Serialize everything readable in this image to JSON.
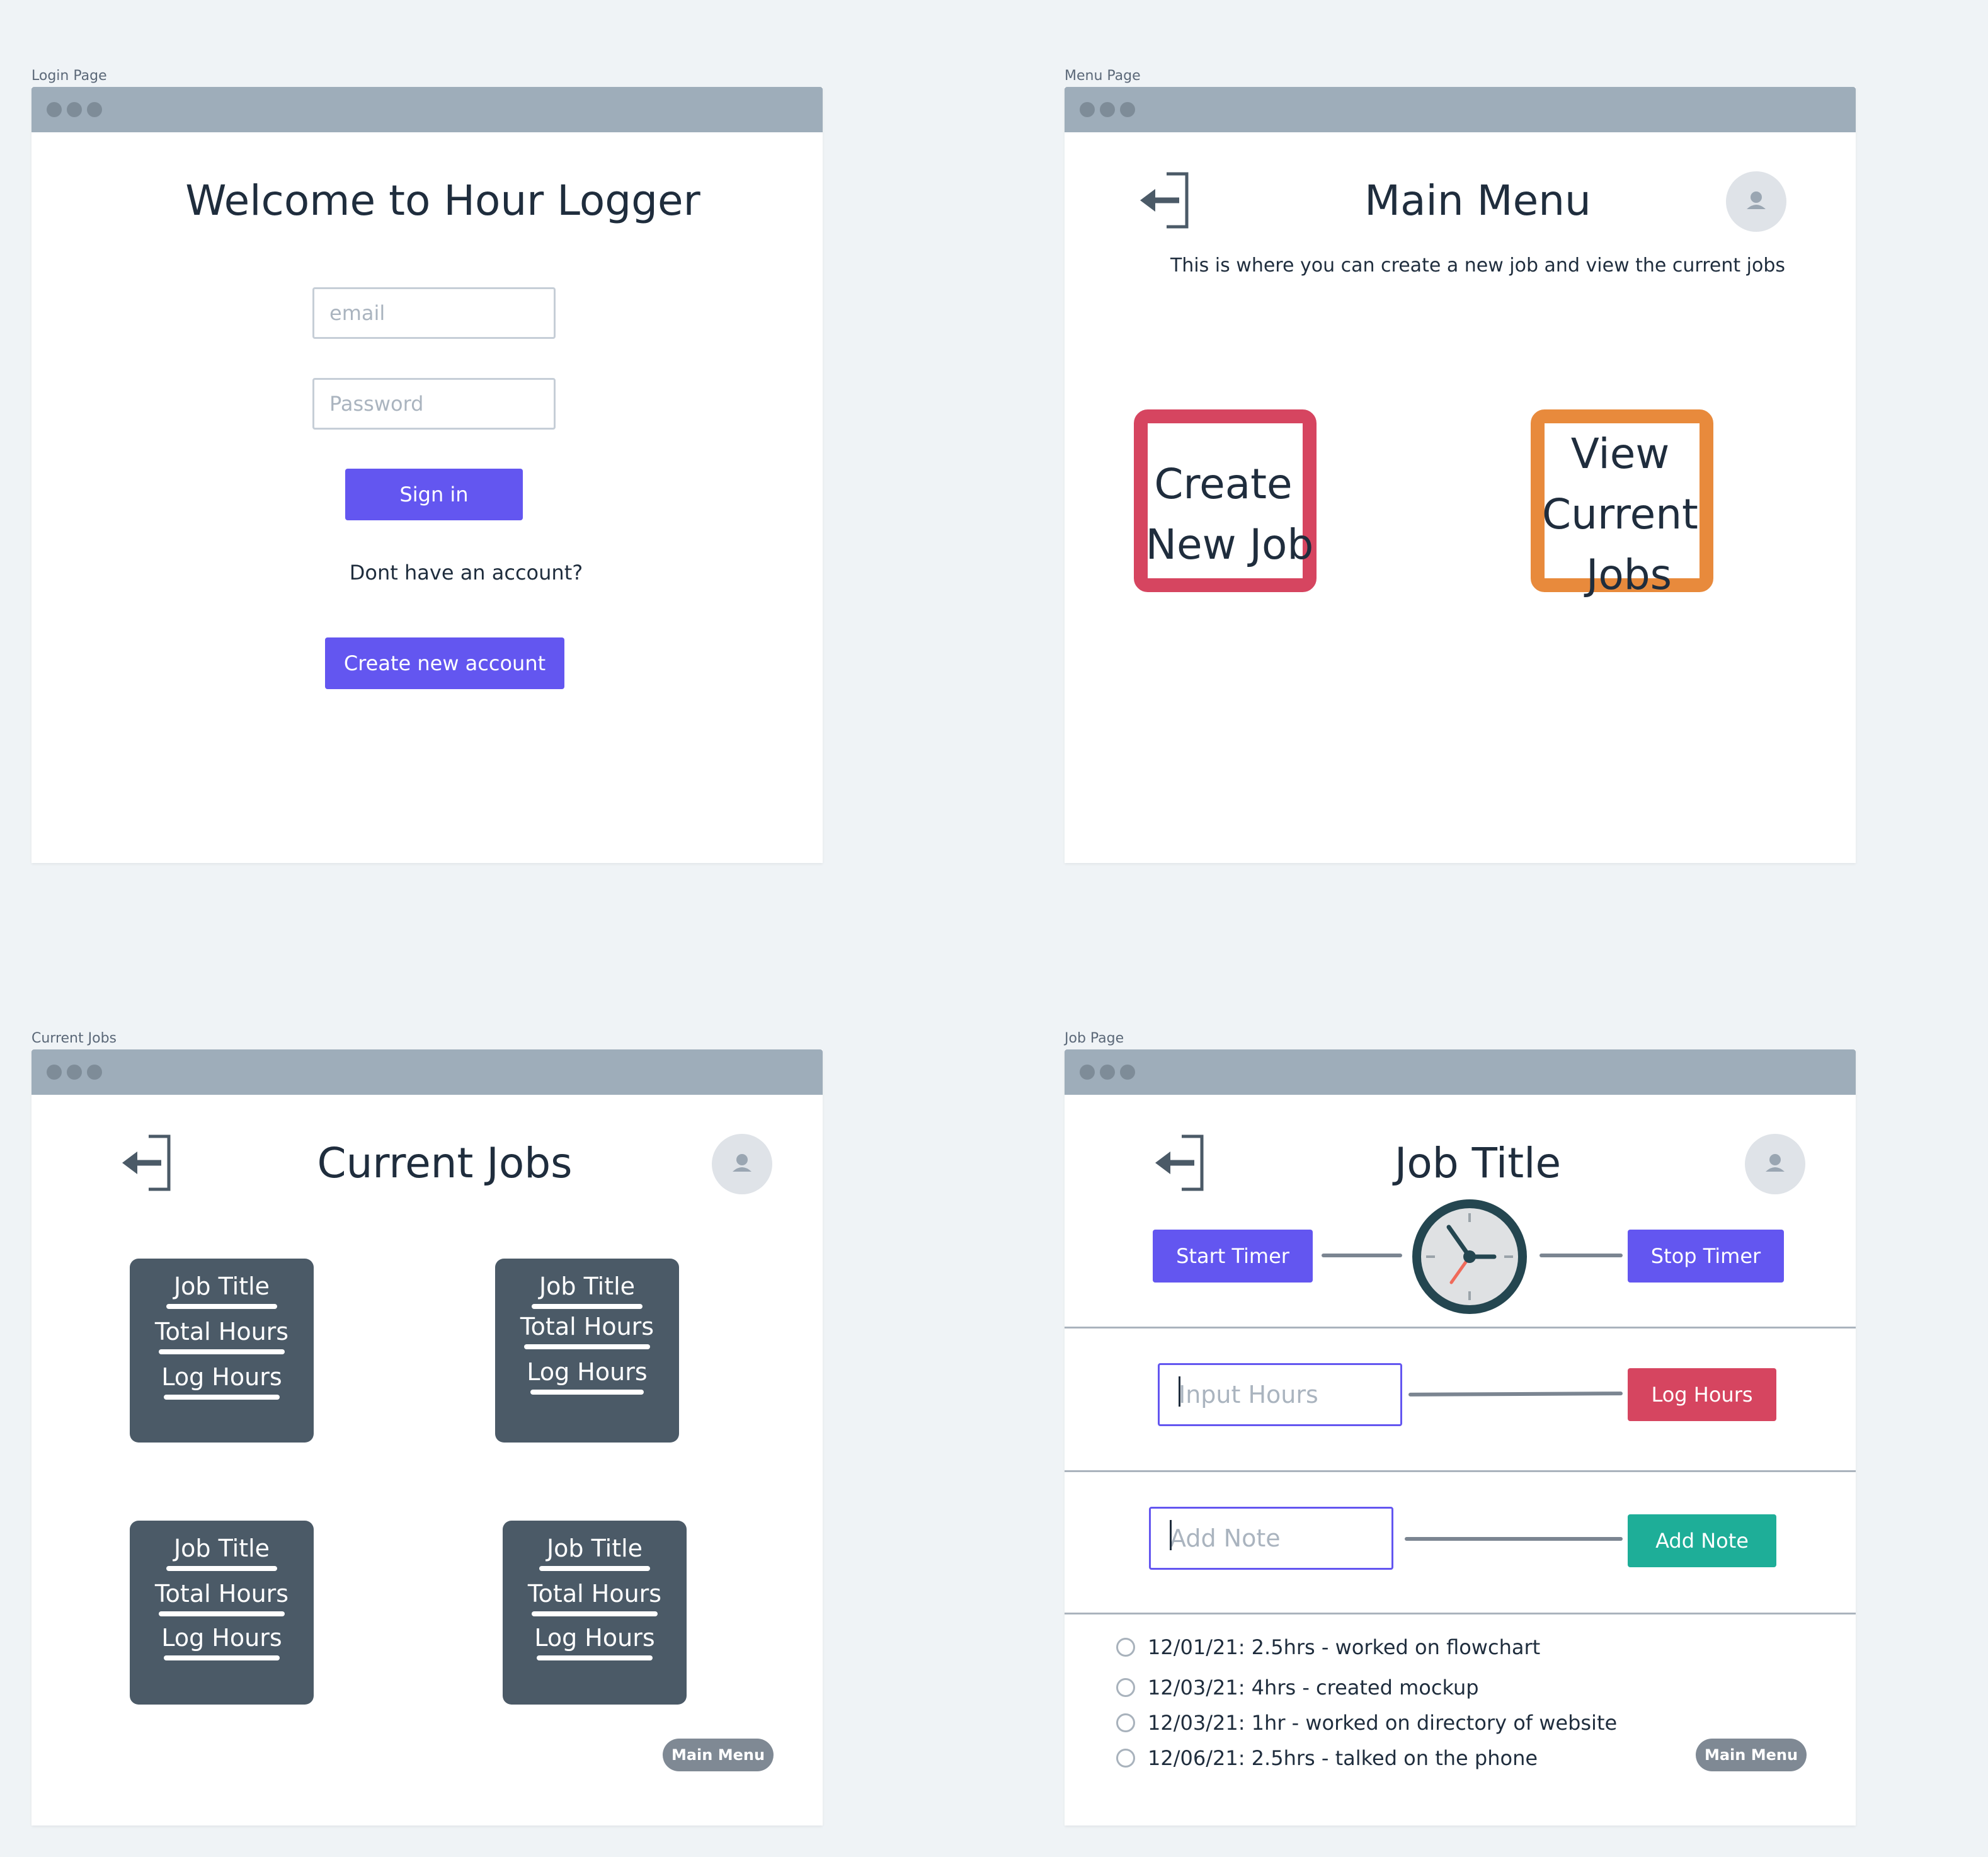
{
  "login": {
    "frame_label": "Login Page",
    "title": "Welcome to Hour Logger",
    "email_placeholder": "email",
    "password_placeholder": "Password",
    "signin_label": "Sign in",
    "no_account_text": "Dont have an account?",
    "create_account_label": "Create new account"
  },
  "menu": {
    "frame_label": "Menu Page",
    "title": "Main Menu",
    "subtitle": "This is where you can create a new job and view the current jobs",
    "create_line1": "Create",
    "create_line2": "New Job",
    "view_line1": "View",
    "view_line2": "Current",
    "view_line3": "Jobs",
    "create_color": "#d64560",
    "view_color": "#e88a3c"
  },
  "current_jobs": {
    "frame_label": "Current Jobs",
    "title": "Current Jobs",
    "tiles": [
      {
        "title": "Job Title",
        "total": "Total Hours",
        "log": "Log Hours"
      },
      {
        "title": "Job Title",
        "total": "Total Hours",
        "log": "Log Hours"
      },
      {
        "title": "Job Title",
        "total": "Total Hours",
        "log": "Log Hours"
      },
      {
        "title": "Job Title",
        "total": "Total Hours",
        "log": "Log Hours"
      }
    ],
    "main_menu_label": "Main Menu"
  },
  "job": {
    "frame_label": "Job Page",
    "title": "Job Title",
    "start_timer_label": "Start Timer",
    "stop_timer_label": "Stop Timer",
    "input_hours_placeholder": "Input Hours",
    "log_hours_label": "Log Hours",
    "add_note_placeholder": "Add Note",
    "add_note_label": "Add Note",
    "log_hours_color": "#d64560",
    "add_note_color": "#1eae98",
    "entries": [
      "12/01/21: 2.5hrs - worked on flowchart",
      "12/03/21: 4hrs - created mockup",
      "12/03/21: 1hr - worked on directory of website",
      "12/06/21: 2.5hrs - talked on the phone"
    ],
    "main_menu_label": "Main Menu"
  },
  "icons": {
    "exit": "exit-door-icon",
    "avatar": "user-avatar-icon",
    "clock": "clock-icon"
  }
}
